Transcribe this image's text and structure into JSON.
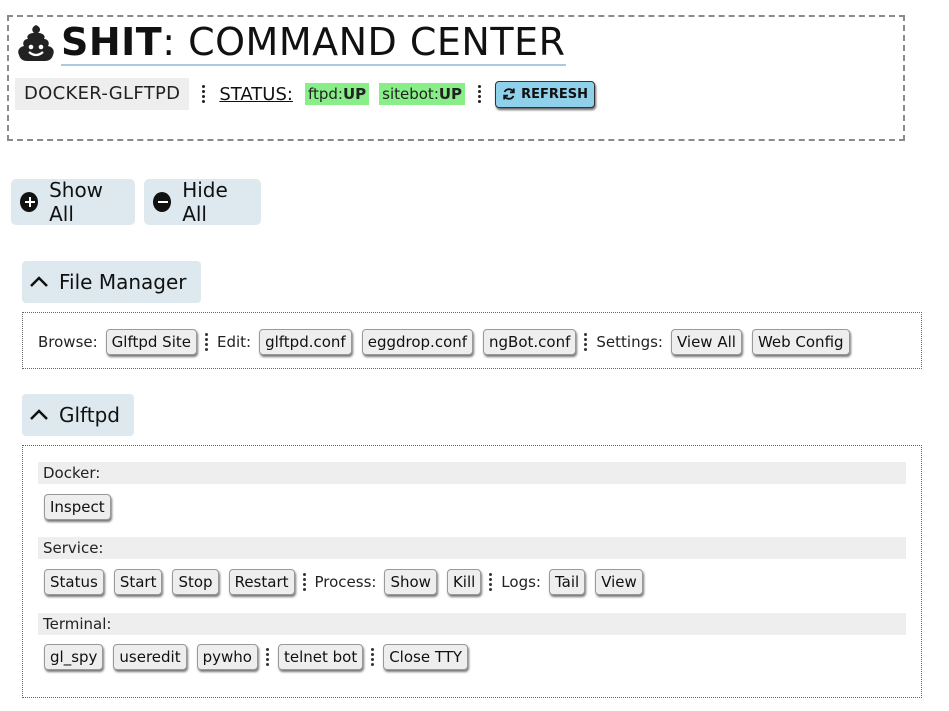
{
  "header": {
    "title_bold": "SHIT",
    "title_rest": ": COMMAND CENTER",
    "host": "DOCKER-GLFTPD",
    "status_label": "STATUS:",
    "badges": [
      {
        "name": "ftpd:",
        "state": "UP"
      },
      {
        "name": "sitebot:",
        "state": "UP"
      }
    ],
    "refresh_label": "REFRESH",
    "badge_color": "#88ee88",
    "refresh_color": "#8fd1ea"
  },
  "controls": {
    "show_all": "Show All",
    "hide_all": "Hide All"
  },
  "file_manager": {
    "title": "File Manager",
    "browse_label": "Browse:",
    "browse_buttons": [
      "Glftpd Site"
    ],
    "edit_label": "Edit:",
    "edit_buttons": [
      "glftpd.conf",
      "eggdrop.conf",
      "ngBot.conf"
    ],
    "settings_label": "Settings:",
    "settings_buttons": [
      "View All",
      "Web Config"
    ]
  },
  "glftpd": {
    "title": "Glftpd",
    "docker": {
      "label": "Docker:",
      "buttons": [
        "Inspect"
      ]
    },
    "service": {
      "label": "Service:",
      "buttons": [
        "Status",
        "Start",
        "Stop",
        "Restart"
      ],
      "process_label": "Process:",
      "process_buttons": [
        "Show",
        "Kill"
      ],
      "logs_label": "Logs:",
      "logs_buttons": [
        "Tail",
        "View"
      ]
    },
    "terminal": {
      "label": "Terminal:",
      "buttons": [
        "gl_spy",
        "useredit",
        "pywho"
      ],
      "bot_buttons": [
        "telnet bot"
      ],
      "close_buttons": [
        "Close TTY"
      ]
    }
  },
  "section_color": "#dde9ee"
}
